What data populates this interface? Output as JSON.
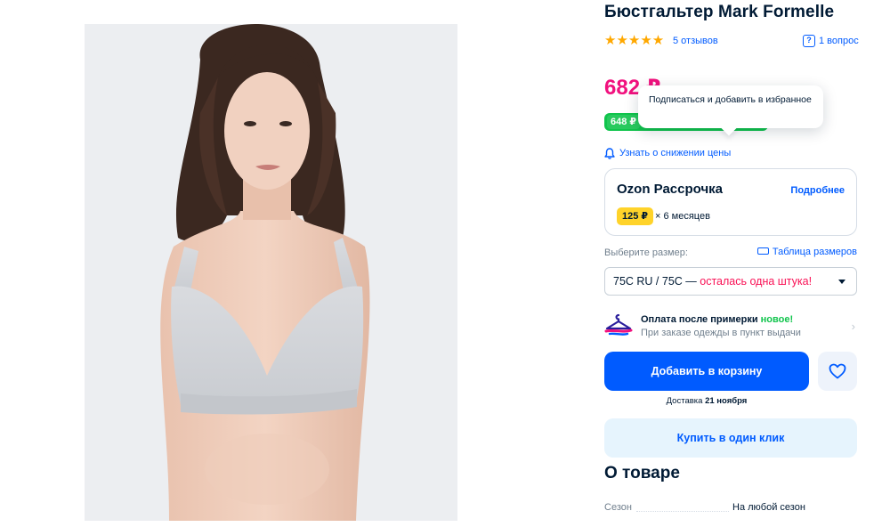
{
  "product": {
    "title": "Бюстгальтер Mark Formelle",
    "rating_stars": "★★★★★",
    "reviews_label": "5 отзывов",
    "question_icon_glyph": "?",
    "questions_label": "1 вопрос",
    "price": "682 ₽",
    "card_price": "648 ₽",
    "tooltip_text": "Подписаться и добавить в избранное",
    "price_alert_label": "Узнать о снижении цены"
  },
  "installment": {
    "title": "Ozon Рассрочка",
    "more_label": "Подробнее",
    "amount": "125 ₽",
    "term": "× 6 месяцев"
  },
  "size": {
    "label": "Выберите размер:",
    "table_label": "Таблица размеров",
    "selected_value": "75C RU / 75C — ",
    "stock_note": "осталась одна штука!"
  },
  "tryon": {
    "title": "Оплата после примерки ",
    "badge": "новое!",
    "subtitle": "При заказе одежды в пункт выдачи"
  },
  "actions": {
    "add_to_cart": "Добавить в корзину",
    "delivery_prefix": "Доставка ",
    "delivery_date": "21 ноября",
    "buy_one_click": "Купить в один клик"
  },
  "about": {
    "title": "О товаре",
    "specs": [
      {
        "key": "Сезон",
        "value": "На любой сезон"
      }
    ]
  },
  "colors": {
    "brand_blue": "#005bff",
    "price_pink": "#f1117e",
    "ozon_card_green": "#10c44c",
    "installment_yellow": "#ffd32a",
    "rating_star": "#ffa800",
    "stock_warning": "#f91155"
  },
  "icons": {
    "rating": "star-icon",
    "question": "question-icon",
    "bell": "bell-icon",
    "ruler": "ruler-icon",
    "hanger": "hanger-icon",
    "favorite": "heart-icon",
    "chevron": "chevron-right-icon",
    "dropdown": "chevron-down-icon"
  }
}
